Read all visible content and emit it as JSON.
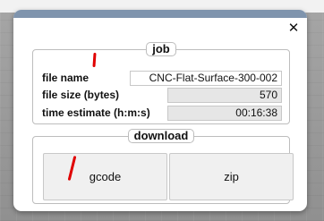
{
  "dialog": {
    "close_symbol": "✕",
    "close_icon": "close-icon",
    "accent_color": "#7f94ad"
  },
  "job": {
    "legend": "job",
    "file_name_label": "file name",
    "file_name_value": "CNC-Flat-Surface-300-002",
    "file_size_label": "file size (bytes)",
    "file_size_value": "570",
    "time_estimate_label": "time estimate (h:m:s)",
    "time_estimate_value": "00:16:38"
  },
  "download": {
    "legend": "download",
    "gcode_label": "gcode",
    "zip_label": "zip"
  }
}
